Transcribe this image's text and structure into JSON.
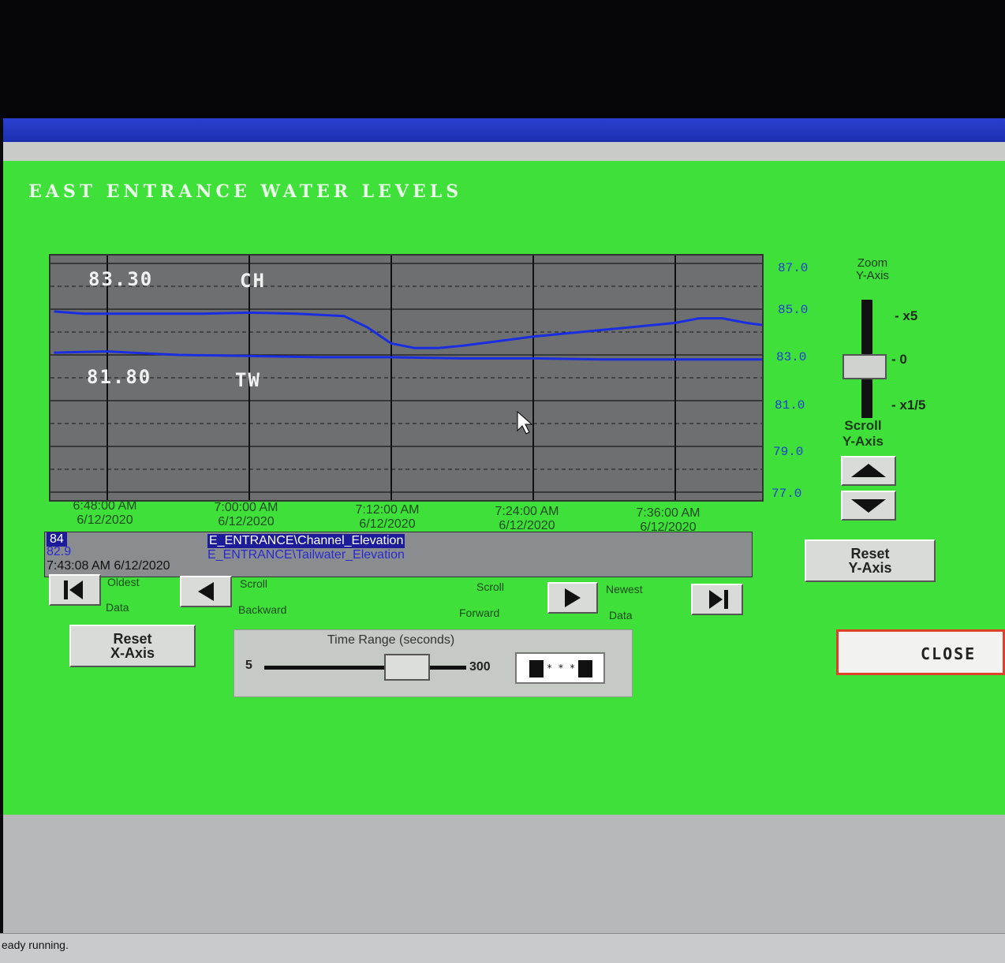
{
  "screen_title": "EAST ENTRANCE WATER LEVELS",
  "status": "eady running.",
  "readouts": [
    {
      "value": "83.30",
      "tag": "CH"
    },
    {
      "value": "81.80",
      "tag": "TW"
    }
  ],
  "chart_data": {
    "type": "line",
    "y_ticks": [
      "87.0",
      "85.0",
      "83.0",
      "81.0",
      "79.0",
      "77.0"
    ],
    "ylim": [
      77.0,
      87.0
    ],
    "x_ticks": [
      {
        "time": "6:48:00 AM",
        "date": "6/12/2020"
      },
      {
        "time": "7:00:00 AM",
        "date": "6/12/2020"
      },
      {
        "time": "7:12:00 AM",
        "date": "6/12/2020"
      },
      {
        "time": "7:24:00 AM",
        "date": "6/12/2020"
      },
      {
        "time": "7:36:00 AM",
        "date": "6/12/2020"
      }
    ],
    "x_minutes": [
      0,
      12,
      24,
      36,
      48
    ],
    "series": [
      {
        "name": "E_ENTRANCE\\Channel_Elevation",
        "color": "#1a2ee0",
        "x": [
          -4.5,
          -2,
          3,
          8,
          12,
          16,
          20,
          22,
          24,
          26,
          28,
          30,
          33,
          36,
          40,
          44,
          48,
          50,
          52,
          54,
          55.5
        ],
        "y": [
          84.9,
          84.8,
          84.8,
          84.8,
          84.85,
          84.8,
          84.7,
          84.2,
          83.5,
          83.3,
          83.3,
          83.4,
          83.6,
          83.8,
          84.0,
          84.2,
          84.4,
          84.6,
          84.6,
          84.4,
          84.3
        ]
      },
      {
        "name": "E_ENTRANCE\\Tailwater_Elevation",
        "color": "#1a2ee0",
        "x": [
          -4.5,
          0,
          6,
          12,
          18,
          24,
          30,
          36,
          42,
          48,
          55.5
        ],
        "y": [
          83.1,
          83.15,
          83.0,
          82.95,
          82.9,
          82.9,
          82.85,
          82.85,
          82.8,
          82.8,
          82.8
        ]
      }
    ]
  },
  "legend": {
    "value1": "84",
    "value2": "82.9",
    "timestamp": "7:43:08 AM   6/12/2020",
    "name1": "E_ENTRANCE\\Channel_Elevation",
    "name2": "E_ENTRANCE\\Tailwater_Elevation"
  },
  "nav": {
    "oldest_l1": "Oldest",
    "oldest_l2": "Data",
    "scroll_back_l1": "Scroll",
    "scroll_back_l2": "Backward",
    "scroll_fwd_l1": "Scroll",
    "scroll_fwd_l2": "Forward",
    "newest_l1": "Newest",
    "newest_l2": "Data"
  },
  "zoom": {
    "title_l1": "Zoom",
    "title_l2": "Y-Axis",
    "mark_x5": "- x5",
    "mark_0": "- 0",
    "mark_x15": "- x1/5",
    "scroll_l1": "Scroll",
    "scroll_l2": "Y-Axis"
  },
  "buttons": {
    "reset_y_l1": "Reset",
    "reset_y_l2": "Y-Axis",
    "reset_x_l1": "Reset",
    "reset_x_l2": "X-Axis",
    "close": "CLOSE"
  },
  "time_range": {
    "title": "Time Range (seconds)",
    "min": "5",
    "max": "300",
    "field": "* * *"
  }
}
